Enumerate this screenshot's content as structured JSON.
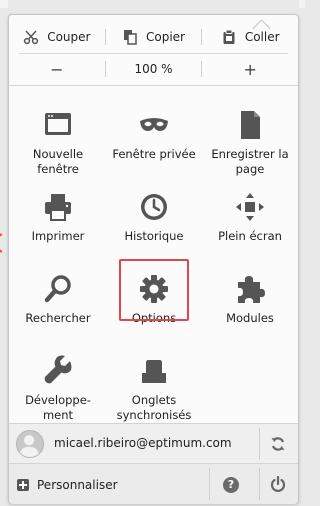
{
  "edit": {
    "cut_label": "Couper",
    "copy_label": "Copier",
    "paste_label": "Coller"
  },
  "zoom": {
    "minus": "−",
    "level": "100 %",
    "plus": "+"
  },
  "grid": [
    {
      "label": "Nouvelle fenêtre",
      "icon": "new-window-icon"
    },
    {
      "label": "Fenêtre privée",
      "icon": "private-mask-icon"
    },
    {
      "label": "Enregistrer la page",
      "icon": "save-page-icon"
    },
    {
      "label": "Imprimer",
      "icon": "printer-icon"
    },
    {
      "label": "Historique",
      "icon": "clock-icon"
    },
    {
      "label": "Plein écran",
      "icon": "fullscreen-icon"
    },
    {
      "label": "Rechercher",
      "icon": "magnifier-icon"
    },
    {
      "label": "Options",
      "icon": "gear-icon"
    },
    {
      "label": "Modules",
      "icon": "puzzle-icon"
    },
    {
      "label": "Développe-ment",
      "icon": "wrench-icon"
    },
    {
      "label": "Onglets synchronisés",
      "icon": "synced-tabs-icon"
    }
  ],
  "account": {
    "email": "micael.ribeiro@eptimum.com"
  },
  "footer": {
    "customize_label": "Personnaliser",
    "help_symbol": "?"
  },
  "colors": {
    "highlight": "#e2474b",
    "icon": "#555555"
  }
}
